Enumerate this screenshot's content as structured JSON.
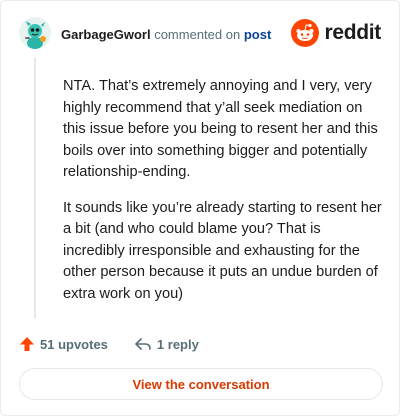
{
  "header": {
    "author": "GarbageGworl",
    "action_text": "commented on",
    "post_link": "post",
    "brand": "reddit"
  },
  "colors": {
    "reddit_orange": "#ff4500",
    "upvote": "#ff4500",
    "button_text": "#d93a00",
    "link": "#0a449b",
    "muted": "#576f76"
  },
  "comment": {
    "paragraphs": [
      "NTA. That’s extremely annoying and I very, very highly recommend that y’all seek mediation on this issue before you being to resent her and this boils over into something bigger and potentially relationship-ending.",
      "It sounds like you’re already starting to resent her a bit (and who could blame you? That is incredibly irresponsible and exhausting for the other person because it puts an undue burden of extra work on you)"
    ]
  },
  "actions": {
    "upvotes": "51 upvotes",
    "replies": "1 reply",
    "upvote_icon": "upvote-arrow-icon",
    "reply_icon": "reply-arrow-icon"
  },
  "view_button": "View the conversation"
}
